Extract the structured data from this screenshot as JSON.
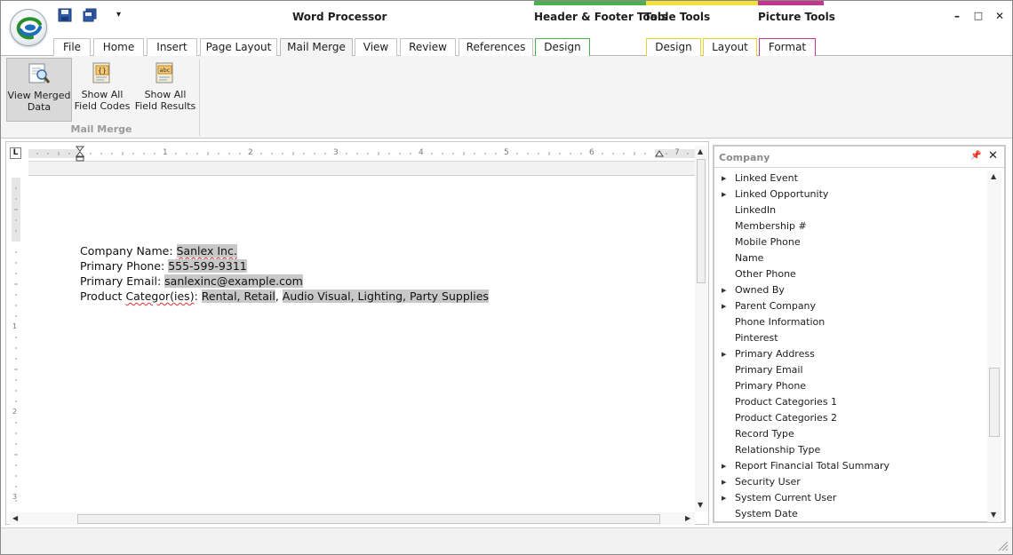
{
  "app": {
    "title": "Word Processor",
    "contextual": [
      {
        "label": "Header & Footer Tools",
        "color": "#4caf50"
      },
      {
        "label": "Table Tools",
        "color": "#f0e23a"
      },
      {
        "label": "Picture Tools",
        "color": "#c2378b"
      }
    ],
    "window_buttons": [
      "–",
      "□",
      "✕"
    ]
  },
  "tabs": [
    {
      "label": "File"
    },
    {
      "label": "Home"
    },
    {
      "label": "Insert"
    },
    {
      "label": "Page Layout"
    },
    {
      "label": "Mail Merge",
      "active": true
    },
    {
      "label": "View"
    },
    {
      "label": "Review"
    },
    {
      "label": "References"
    },
    {
      "label": "Design",
      "context": "header-footer"
    },
    {
      "label": "Design",
      "context": "table"
    },
    {
      "label": "Layout",
      "context": "table"
    },
    {
      "label": "Format",
      "context": "picture"
    }
  ],
  "ribbon": {
    "group_label": "Mail Merge",
    "buttons": [
      {
        "line1": "View Merged",
        "line2": "Data",
        "icon": "magnifier-document-icon",
        "pressed": true
      },
      {
        "line1": "Show All",
        "line2": "Field Codes",
        "icon": "field-codes-icon",
        "pressed": false
      },
      {
        "line1": "Show All",
        "line2": "Field Results",
        "icon": "field-results-icon",
        "pressed": false
      }
    ]
  },
  "ruler": {
    "corner": "L",
    "numbers": [
      "1",
      "2",
      "3",
      "4",
      "5",
      "6",
      "7"
    ],
    "vertical_numbers": [
      "1",
      "2",
      "3"
    ]
  },
  "document": {
    "lines": [
      {
        "label": "Company Name: ",
        "value": "Sanlex Inc."
      },
      {
        "label": "Primary Phone: ",
        "value": "555-599-9311"
      },
      {
        "label": "Primary Email: ",
        "value": "sanlexinc@example.com"
      },
      {
        "label_pre": "Product ",
        "label_squig": "Categor(ies)",
        "label_post": ": ",
        "value_pre": "Rental, Retail",
        "value_sep": ", ",
        "value_post": "Audio Visual, Lighting, Party Supplies"
      }
    ]
  },
  "panel": {
    "title": "Company",
    "pin": "📌",
    "close": "✕",
    "items": [
      {
        "label": "Linked Event",
        "expandable": true
      },
      {
        "label": "Linked Opportunity",
        "expandable": true
      },
      {
        "label": "LinkedIn",
        "expandable": false
      },
      {
        "label": "Membership #",
        "expandable": false
      },
      {
        "label": "Mobile Phone",
        "expandable": false
      },
      {
        "label": "Name",
        "expandable": false
      },
      {
        "label": "Other Phone",
        "expandable": false
      },
      {
        "label": "Owned By",
        "expandable": true
      },
      {
        "label": "Parent Company",
        "expandable": true
      },
      {
        "label": "Phone Information",
        "expandable": false
      },
      {
        "label": "Pinterest",
        "expandable": false
      },
      {
        "label": "Primary Address",
        "expandable": true
      },
      {
        "label": "Primary Email",
        "expandable": false
      },
      {
        "label": "Primary Phone",
        "expandable": false
      },
      {
        "label": "Product Categories 1",
        "expandable": false
      },
      {
        "label": "Product Categories 2",
        "expandable": false
      },
      {
        "label": "Record Type",
        "expandable": false
      },
      {
        "label": "Relationship Type",
        "expandable": false
      },
      {
        "label": "Report Financial Total Summary",
        "expandable": true
      },
      {
        "label": "Security User",
        "expandable": true
      },
      {
        "label": "System Current User",
        "expandable": true
      },
      {
        "label": "System Date",
        "expandable": false
      }
    ]
  },
  "colors": {
    "field_highlight": "#c8c8c8",
    "group_label": "#9a9a9a",
    "active_tab_bg": "#f4f4f4"
  }
}
